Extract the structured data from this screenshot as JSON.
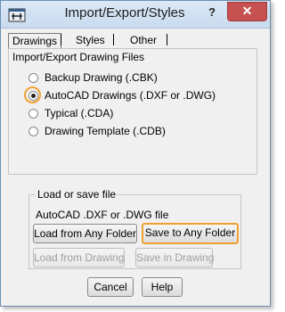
{
  "window": {
    "title": "Import/Export/Styles",
    "help_label": "?",
    "close_label": "✕"
  },
  "tabs": [
    {
      "label": "Drawings"
    },
    {
      "label": "Styles"
    },
    {
      "label": "Other"
    }
  ],
  "panel": {
    "title": "Import/Export Drawing Files",
    "options": [
      {
        "label": "Backup Drawing (.CBK)",
        "checked": false
      },
      {
        "label": "AutoCAD Drawings (.DXF or .DWG)",
        "checked": true
      },
      {
        "label": "Typical (.CDA)",
        "checked": false
      },
      {
        "label": "Drawing Template (.CDB)",
        "checked": false
      }
    ]
  },
  "load_save": {
    "title": "Load or save file",
    "file_type": "AutoCAD .DXF or .DWG file",
    "load_folder_label": "Load from Any Folder",
    "save_folder_label": "Save to Any Folder",
    "load_drawing_label": "Load from Drawing",
    "save_drawing_label": "Save in Drawing"
  },
  "footer": {
    "cancel_label": "Cancel",
    "help_label": "Help"
  },
  "colors": {
    "highlight": "#f0a030",
    "close_button": "#c75050",
    "titlebar": "#c8dbef"
  },
  "icons": {
    "app": "app-window-icon",
    "help": "help-icon",
    "close": "close-icon"
  }
}
